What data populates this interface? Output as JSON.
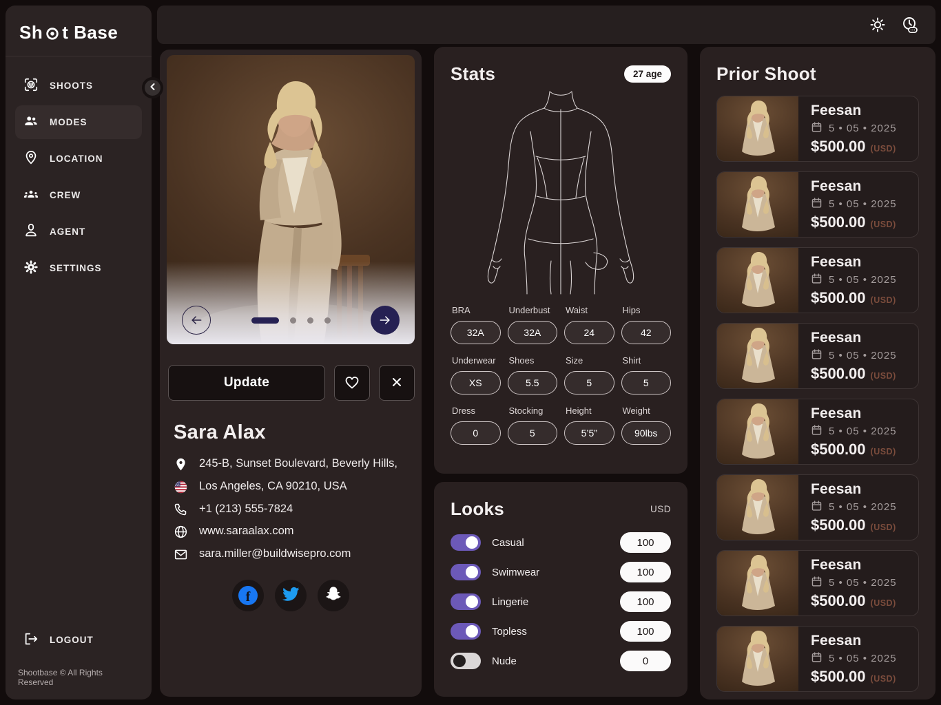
{
  "sidebar": {
    "logo_part1": "Sh",
    "logo_part2": "t Base",
    "items": [
      {
        "label": "SHOOTS",
        "active": false
      },
      {
        "label": "MODES",
        "active": true
      },
      {
        "label": "LOCATION",
        "active": false
      },
      {
        "label": "CREW",
        "active": false
      },
      {
        "label": "AGENT",
        "active": false
      },
      {
        "label": "SETTINGS",
        "active": false
      }
    ],
    "logout_label": "LOGOUT",
    "footer": "Shootbase © All Rights Reserved"
  },
  "profile": {
    "update_label": "Update",
    "name": "Sara Alax",
    "contact": {
      "address": "245-B, Sunset Boulevard, Beverly Hills,",
      "city": "Los Angeles, CA 90210, USA",
      "phone": "+1 (213) 555-7824",
      "website": "www.saraalax.com",
      "email": "sara.miller@buildwisepro.com"
    }
  },
  "stats": {
    "title": "Stats",
    "age_badge": "27 age",
    "fields": [
      {
        "label": "BRA",
        "value": "32A"
      },
      {
        "label": "Underbust",
        "value": "32A"
      },
      {
        "label": "Waist",
        "value": "24"
      },
      {
        "label": "Hips",
        "value": "42"
      },
      {
        "label": "Underwear",
        "value": "XS"
      },
      {
        "label": "Shoes",
        "value": "5.5"
      },
      {
        "label": "Size",
        "value": "5"
      },
      {
        "label": "Shirt",
        "value": "5"
      },
      {
        "label": "Dress",
        "value": "0"
      },
      {
        "label": "Stocking",
        "value": "5"
      },
      {
        "label": "Height",
        "value": "5’5”"
      },
      {
        "label": "Weight",
        "value": "90lbs"
      }
    ]
  },
  "looks": {
    "title": "Looks",
    "currency_label": "USD",
    "items": [
      {
        "label": "Casual",
        "value": "100",
        "enabled": true
      },
      {
        "label": "Swimwear",
        "value": "100",
        "enabled": true
      },
      {
        "label": "Lingerie",
        "value": "100",
        "enabled": true
      },
      {
        "label": "Topless",
        "value": "100",
        "enabled": true
      },
      {
        "label": "Nude",
        "value": "0",
        "enabled": false
      }
    ]
  },
  "prior": {
    "title": "Prior Shoot",
    "cards": [
      {
        "name": "Feesan",
        "date": "5 • 05 • 2025",
        "price": "$500.00",
        "currency": "(USD)"
      },
      {
        "name": "Feesan",
        "date": "5 • 05 • 2025",
        "price": "$500.00",
        "currency": "(USD)"
      },
      {
        "name": "Feesan",
        "date": "5 • 05 • 2025",
        "price": "$500.00",
        "currency": "(USD)"
      },
      {
        "name": "Feesan",
        "date": "5 • 05 • 2025",
        "price": "$500.00",
        "currency": "(USD)"
      },
      {
        "name": "Feesan",
        "date": "5 • 05 • 2025",
        "price": "$500.00",
        "currency": "(USD)"
      },
      {
        "name": "Feesan",
        "date": "5 • 05 • 2025",
        "price": "$500.00",
        "currency": "(USD)"
      },
      {
        "name": "Feesan",
        "date": "5 • 05 • 2025",
        "price": "$500.00",
        "currency": "(USD)"
      },
      {
        "name": "Feesan",
        "date": "5 • 05 • 2025",
        "price": "$500.00",
        "currency": "(USD)"
      }
    ]
  },
  "colors": {
    "accent_purple": "#6c59b8",
    "carousel_navy": "#262153",
    "facebook_blue": "#1877f2",
    "twitter_blue": "#1d9bf0",
    "usd_muted": "#7b4c3c",
    "panel_bg": "#292020",
    "page_bg": "#120c0c"
  }
}
